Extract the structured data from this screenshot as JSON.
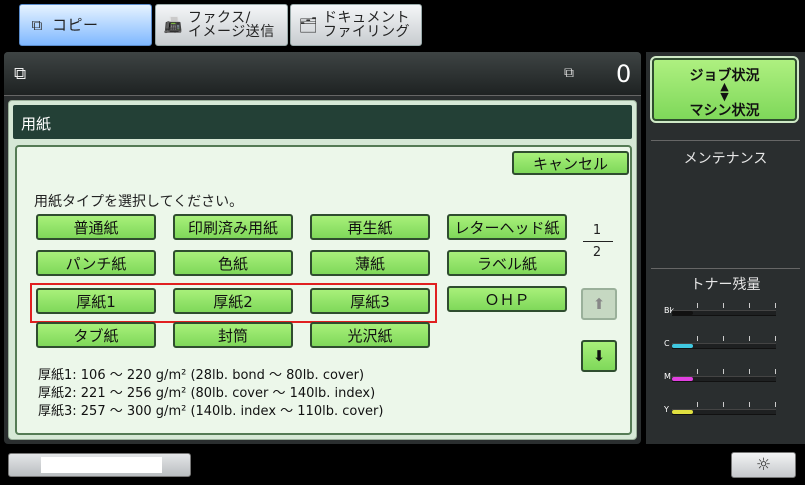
{
  "tabs": [
    {
      "label": "コピー",
      "icon": "copy-icon",
      "active": true
    },
    {
      "label": "ファクス/\nイメージ送信",
      "icon": "fax-icon",
      "active": false
    },
    {
      "label": "ドキュメント\nファイリング",
      "icon": "document-filing-icon",
      "active": false
    }
  ],
  "status": {
    "copies_count": "0"
  },
  "panel": {
    "title": "用紙",
    "cancel_label": "キャンセル",
    "instruction": "用紙タイプを選択してください。",
    "paper_types": [
      [
        "普通紙",
        "印刷済み用紙",
        "再生紙",
        "レターヘッド紙"
      ],
      [
        "パンチ紙",
        "色紙",
        "薄紙",
        "ラベル紙"
      ],
      [
        "厚紙1",
        "厚紙2",
        "厚紙3",
        "ＯＨＰ"
      ],
      [
        "タブ紙",
        "封筒",
        "光沢紙"
      ]
    ],
    "page": {
      "current": "1",
      "total": "2"
    },
    "notes": [
      "厚紙1: 106 ～ 220 g/m² (28lb. bond ～ 80lb. cover)",
      "厚紙2: 221 ～ 256 g/m² (80lb. cover ～ 140lb. index)",
      "厚紙3: 257 ～ 300 g/m² (140lb. index ～ 110lb. cover)"
    ]
  },
  "side": {
    "job_status_label": "ジョブ状況",
    "machine_status_label": "マシン状況",
    "maintenance_label": "メンテナンス",
    "toner_title": "トナー残量",
    "toner": [
      {
        "code": "Bk",
        "color": "#111111",
        "level": 0.2
      },
      {
        "code": "C",
        "color": "#40c8e0",
        "level": 0.2
      },
      {
        "code": "M",
        "color": "#e040e0",
        "level": 0.2
      },
      {
        "code": "Y",
        "color": "#e0e040",
        "level": 0.2
      }
    ]
  },
  "bottom": {
    "progress": 0.8
  },
  "colors": {
    "button_green": "#7fd85a",
    "highlight_red": "#e02020",
    "title_bar": "#234036"
  }
}
